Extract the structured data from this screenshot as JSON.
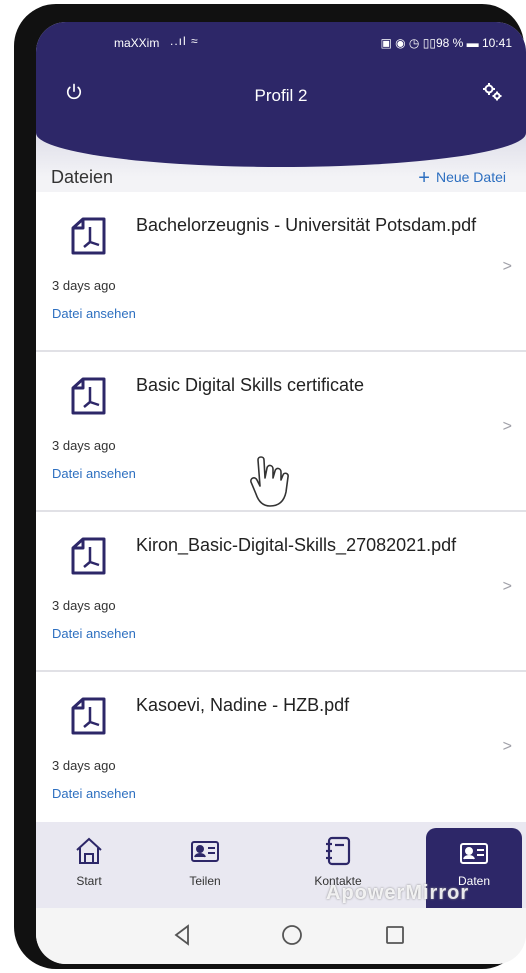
{
  "status": {
    "carrier": "maXXim",
    "signal": "..ıl ≈",
    "right": "▣ ◉ ◷ ▯▯98 % ▬ 10:41"
  },
  "header": {
    "title": "Profil 2"
  },
  "section": {
    "label": "Dateien",
    "new_label": "Neue Datei"
  },
  "files": [
    {
      "name": "Bachelorzeugnis - Universität Potsdam.pdf",
      "date": "3 days ago",
      "action": "Datei ansehen"
    },
    {
      "name": "Basic Digital Skills certificate",
      "date": "3 days ago",
      "action": "Datei ansehen"
    },
    {
      "name": "Kiron_Basic-Digital-Skills_27082021.pdf",
      "date": "3 days ago",
      "action": "Datei ansehen"
    },
    {
      "name": "Kasoevi, Nadine - HZB.pdf",
      "date": "3 days ago",
      "action": "Datei ansehen"
    }
  ],
  "tabs": [
    {
      "label": "Start",
      "icon": "home-icon"
    },
    {
      "label": "Teilen",
      "icon": "id-card-icon"
    },
    {
      "label": "Kontakte",
      "icon": "address-book-icon"
    },
    {
      "label": "Daten",
      "icon": "id-card-icon"
    }
  ],
  "watermark": "ApowerMirror",
  "colors": {
    "primary": "#2d2768",
    "link": "#2d6fc0",
    "background": "#f3f3f6"
  }
}
